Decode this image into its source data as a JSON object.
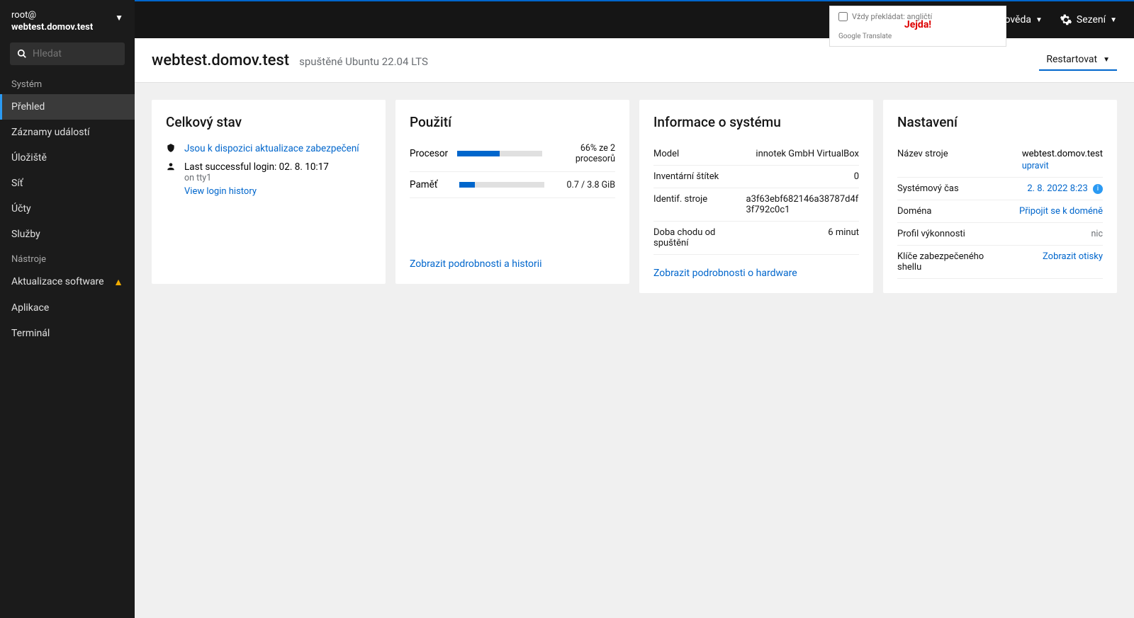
{
  "host_selector": {
    "user": "root@",
    "host": "webtest.domov.test"
  },
  "search": {
    "placeholder": "Hledat"
  },
  "nav_section_system": "Systém",
  "nav_section_tools": "Nástroje",
  "nav": {
    "overview": "Přehled",
    "logs": "Záznamy událostí",
    "storage": "Úložiště",
    "network": "Síť",
    "accounts": "Účty",
    "services": "Služby",
    "updates": "Aktualizace software",
    "apps": "Aplikace",
    "terminal": "Terminál"
  },
  "topbar": {
    "help": "Nápověda",
    "session": "Sezení",
    "overlay_check": "Vždy překládat: angličtí",
    "overlay_credit": "Google Translate",
    "overlay_jejda": "Jejda!"
  },
  "header": {
    "title": "webtest.domov.test",
    "subtitle": "spuštěné Ubuntu 22.04 LTS",
    "restart": "Restartovat"
  },
  "health": {
    "title": "Celkový stav",
    "updates_link": "Jsou k dispozici aktualizace zabezpečení",
    "login_line": "Last successful login: 02. 8. 10:17",
    "login_sub": "on tty1",
    "history_link": "View login history"
  },
  "usage": {
    "title": "Použití",
    "cpu_label": "Procesor",
    "cpu_value": "66% ze 2 procesorů",
    "cpu_pct": 50,
    "mem_label": "Paměť",
    "mem_value": "0.7 / 3.8 GiB",
    "mem_pct": 18,
    "link": "Zobrazit podrobnosti a historii"
  },
  "system": {
    "title": "Informace o systému",
    "model_lbl": "Model",
    "model_val": "innotek GmbH VirtualBox",
    "asset_lbl": "Inventární štítek",
    "asset_val": "0",
    "id_lbl": "Identif. stroje",
    "id_val": "a3f63ebf682146a38787d4f3f792c0c1",
    "uptime_lbl": "Doba chodu od spuštění",
    "uptime_val": "6 minut",
    "link": "Zobrazit podrobnosti o hardware"
  },
  "settings": {
    "title": "Nastavení",
    "hostname_lbl": "Název stroje",
    "hostname_val": "webtest.domov.test",
    "hostname_edit": "upravit",
    "time_lbl": "Systémový čas",
    "time_val": "2. 8. 2022 8:23",
    "domain_lbl": "Doména",
    "domain_val": "Připojit se k doméně",
    "profile_lbl": "Profil výkonnosti",
    "profile_val": "nic",
    "ssh_lbl": "Klíče zabezpečeného shellu",
    "ssh_val": "Zobrazit otisky"
  }
}
